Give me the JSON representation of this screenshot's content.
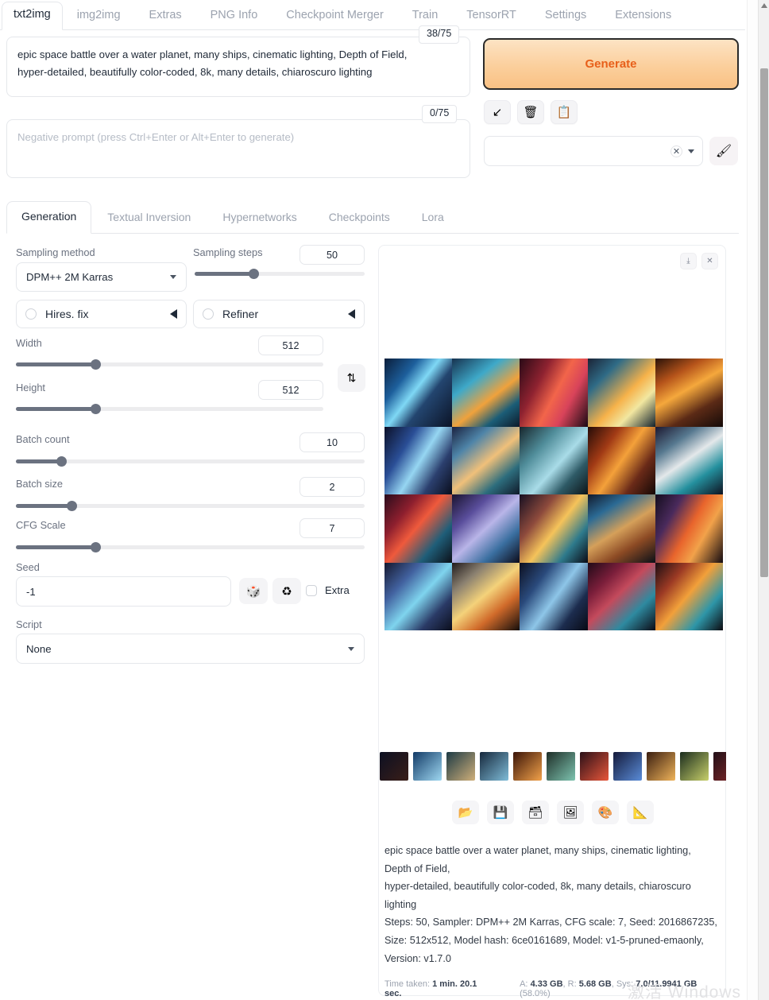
{
  "top_tabs": [
    {
      "label": "txt2img",
      "active": true
    },
    {
      "label": "img2img",
      "active": false
    },
    {
      "label": "Extras",
      "active": false
    },
    {
      "label": "PNG Info",
      "active": false
    },
    {
      "label": "Checkpoint Merger",
      "active": false
    },
    {
      "label": "Train",
      "active": false
    },
    {
      "label": "TensorRT",
      "active": false
    },
    {
      "label": "Settings",
      "active": false
    },
    {
      "label": "Extensions",
      "active": false
    }
  ],
  "prompt": {
    "value": "epic space battle over a water planet, many ships, cinematic lighting, Depth of Field,\nhyper-detailed, beautifully color-coded, 8k, many details, chiaroscuro lighting",
    "token_counter": "38/75"
  },
  "negative_prompt": {
    "value": "",
    "placeholder": "Negative prompt (press Ctrl+Enter or Alt+Enter to generate)",
    "token_counter": "0/75"
  },
  "generate_button": {
    "label": "Generate",
    "text_color": "#e8601a",
    "border_color": "#2a2a2a"
  },
  "prompt_tools": [
    {
      "name": "paste-arrow-icon",
      "glyph": "↙"
    },
    {
      "name": "trash-icon",
      "glyph": "🗑"
    },
    {
      "name": "clipboard-icon",
      "glyph": "📋"
    }
  ],
  "styles_dropdown": {
    "value": "",
    "clear_glyph": "✕"
  },
  "brush_button": {
    "name": "paintbrush-icon",
    "glyph": "🖌"
  },
  "inner_tabs": [
    {
      "label": "Generation",
      "active": true
    },
    {
      "label": "Textual Inversion",
      "active": false
    },
    {
      "label": "Hypernetworks",
      "active": false
    },
    {
      "label": "Checkpoints",
      "active": false
    },
    {
      "label": "Lora",
      "active": false
    }
  ],
  "controls": {
    "sampling_method": {
      "label": "Sampling method",
      "value": "DPM++ 2M Karras"
    },
    "sampling_steps": {
      "label": "Sampling steps",
      "value": "50",
      "fill_pct": 35
    },
    "hires_fix": {
      "label": "Hires. fix",
      "checked": false
    },
    "refiner": {
      "label": "Refiner",
      "checked": false
    },
    "width": {
      "label": "Width",
      "value": "512",
      "fill_pct": 26
    },
    "height": {
      "label": "Height",
      "value": "512",
      "fill_pct": 26
    },
    "swap_button": {
      "name": "swap-dimensions-icon",
      "glyph": "⇅"
    },
    "batch_count": {
      "label": "Batch count",
      "value": "10",
      "fill_pct": 13
    },
    "batch_size": {
      "label": "Batch size",
      "value": "2",
      "fill_pct": 16
    },
    "cfg_scale": {
      "label": "CFG Scale",
      "value": "7",
      "fill_pct": 23
    },
    "seed": {
      "label": "Seed",
      "value": "-1"
    },
    "seed_random_button": {
      "name": "dice-icon",
      "glyph": "🎲"
    },
    "seed_reuse_button": {
      "name": "recycle-icon",
      "glyph": "♻"
    },
    "extra_checkbox": {
      "label": "Extra",
      "checked": false
    },
    "script": {
      "label": "Script",
      "value": "None"
    }
  },
  "gallery": {
    "tools": [
      {
        "name": "download-icon",
        "glyph": "⤓"
      },
      {
        "name": "close-icon",
        "glyph": "✕"
      }
    ],
    "grid_columns": 5,
    "grid_rows": 4,
    "images": [
      {
        "g": "linear-gradient(128deg,#0a1d3a 0%,#1d5f9c 28%,#7fd8f5 46%,#23456f 62%,#0b1326 100%)"
      },
      {
        "g": "linear-gradient(142deg,#17324f 0%,#3ea9c9 32%,#f0a23c 58%,#1b5d77 78%,#0d1a2a 100%)"
      },
      {
        "g": "linear-gradient(118deg,#2a0a16 0%,#8e2230 30%,#f2654a 52%,#d8435a 70%,#1a0a14 100%)"
      },
      {
        "g": "linear-gradient(135deg,#1b2336 0%,#2f6b86 25%,#f6b24a 55%,#f2e7a0 72%,#10202c 100%)"
      },
      {
        "g": "linear-gradient(150deg,#2a1208 0%,#b5531a 26%,#f5a83c 46%,#5b2a16 72%,#140a08 100%)"
      },
      {
        "g": "linear-gradient(122deg,#0b1028 0%,#2a4e96 30%,#96d6f2 52%,#2b3f6e 74%,#090d1c 100%)"
      },
      {
        "g": "linear-gradient(140deg,#1a2240 0%,#4e84a8 26%,#f0c07a 52%,#2d6d7d 76%,#101a2a 100%)"
      },
      {
        "g": "linear-gradient(132deg,#17262c 0%,#4f8c99 30%,#a9dce8 56%,#2e5a66 76%,#0c1418 100%)"
      },
      {
        "g": "linear-gradient(125deg,#250c08 0%,#a13a15 28%,#f4a13a 50%,#6a2a18 74%,#140806 100%)"
      },
      {
        "g": "linear-gradient(145deg,#1c1830 0%,#56788f 26%,#e4e8ea 48%,#24909e 72%,#0e1220 100%)"
      },
      {
        "g": "linear-gradient(130deg,#2a0c1c 0%,#8e1f2e 28%,#ef5a3c 48%,#1f5e79 74%,#0c1018 100%)"
      },
      {
        "g": "linear-gradient(137deg,#1a1430 0%,#5a4e9c 28%,#b9b5e8 50%,#3a6fa0 74%,#0d0c1a 100%)"
      },
      {
        "g": "linear-gradient(128deg,#160f22 0%,#8d4a3c 30%,#f5c35a 52%,#2e7a8c 76%,#0a0a14 100%)"
      },
      {
        "g": "linear-gradient(148deg,#121a2c 0%,#2b6a94 24%,#d5a05a 50%,#8c4a24 72%,#0a1018 100%)"
      },
      {
        "g": "linear-gradient(120deg,#140d1e 0%,#4a2a5c 26%,#e8642c 50%,#f2a24a 68%,#120a10 100%)"
      },
      {
        "g": "linear-gradient(133deg,#15182e 0%,#4262a0 28%,#7fd4ee 52%,#2a3a66 76%,#0b0e1c 100%)"
      },
      {
        "g": "linear-gradient(140deg,#201a1c 0%,#8a8070 24%,#f4d27a 48%,#d06a2a 70%,#140e0c 100%)"
      },
      {
        "g": "linear-gradient(126deg,#0d1020 0%,#2a4a7c 28%,#8ec6e8 52%,#1c2c4e 76%,#080a14 100%)"
      },
      {
        "g": "linear-gradient(136deg,#200a18 0%,#7a1e3a 26%,#c44a5c 46%,#2e8aa0 72%,#0c0a14 100%)"
      },
      {
        "g": "linear-gradient(130deg,#1a0e14 0%,#9c3a24 26%,#f2a03a 48%,#2e96a8 74%,#0c0a10 100%)"
      }
    ],
    "filmstrip_thumbs": [
      "linear-gradient(135deg,#0c1022,#3a1e18)",
      "linear-gradient(135deg,#123a66,#9fd8f2)",
      "linear-gradient(135deg,#1c3a44,#d0b07a)",
      "linear-gradient(135deg,#16283c,#7fbcd8)",
      "linear-gradient(135deg,#3a1408,#f2a24a)",
      "linear-gradient(135deg,#1e2e28,#7ec4b0)",
      "linear-gradient(135deg,#2a1018,#e8563a)",
      "linear-gradient(135deg,#141a3a,#5a8cd8)",
      "linear-gradient(135deg,#3a1e10,#f0b45a)",
      "linear-gradient(135deg,#1a2c1e,#c8d06a)",
      "linear-gradient(135deg,#221018,#8a2a2a)"
    ],
    "action_buttons": [
      {
        "name": "open-folder-icon",
        "glyph": "📂"
      },
      {
        "name": "save-icon",
        "glyph": "💾"
      },
      {
        "name": "save-zip-icon",
        "glyph": "🗃"
      },
      {
        "name": "send-to-img2img-icon",
        "glyph": "🖼"
      },
      {
        "name": "send-to-extras-icon",
        "glyph": "🎨"
      },
      {
        "name": "send-to-inpaint-icon",
        "glyph": "📐"
      }
    ],
    "info": {
      "prompt_line1": "epic space battle over a water planet, many ships, cinematic lighting,",
      "prompt_line2": "Depth of Field,",
      "prompt_line3": "hyper-detailed, beautifully color-coded, 8k, many details, chiaroscuro",
      "prompt_line4": "lighting",
      "params_line1": "Steps: 50, Sampler: DPM++ 2M Karras, CFG scale: 7, Seed: 2016867235,",
      "params_line2": "Size: 512x512, Model hash: 6ce0161689, Model: v1-5-pruned-emaonly,",
      "params_line3": "Version: v1.7.0"
    },
    "status": {
      "time_label": "Time taken:",
      "time_value": "1 min. 20.1 sec.",
      "mem_a_label": "A:",
      "mem_a_value": "4.33 GB",
      "mem_r_label": "R:",
      "mem_r_value": "5.68 GB",
      "mem_sys_label": "Sys:",
      "mem_sys_value": "7.0/11.9941 GB",
      "mem_sys_pct": "(58.0%)"
    }
  },
  "watermark": "激活 Windows"
}
